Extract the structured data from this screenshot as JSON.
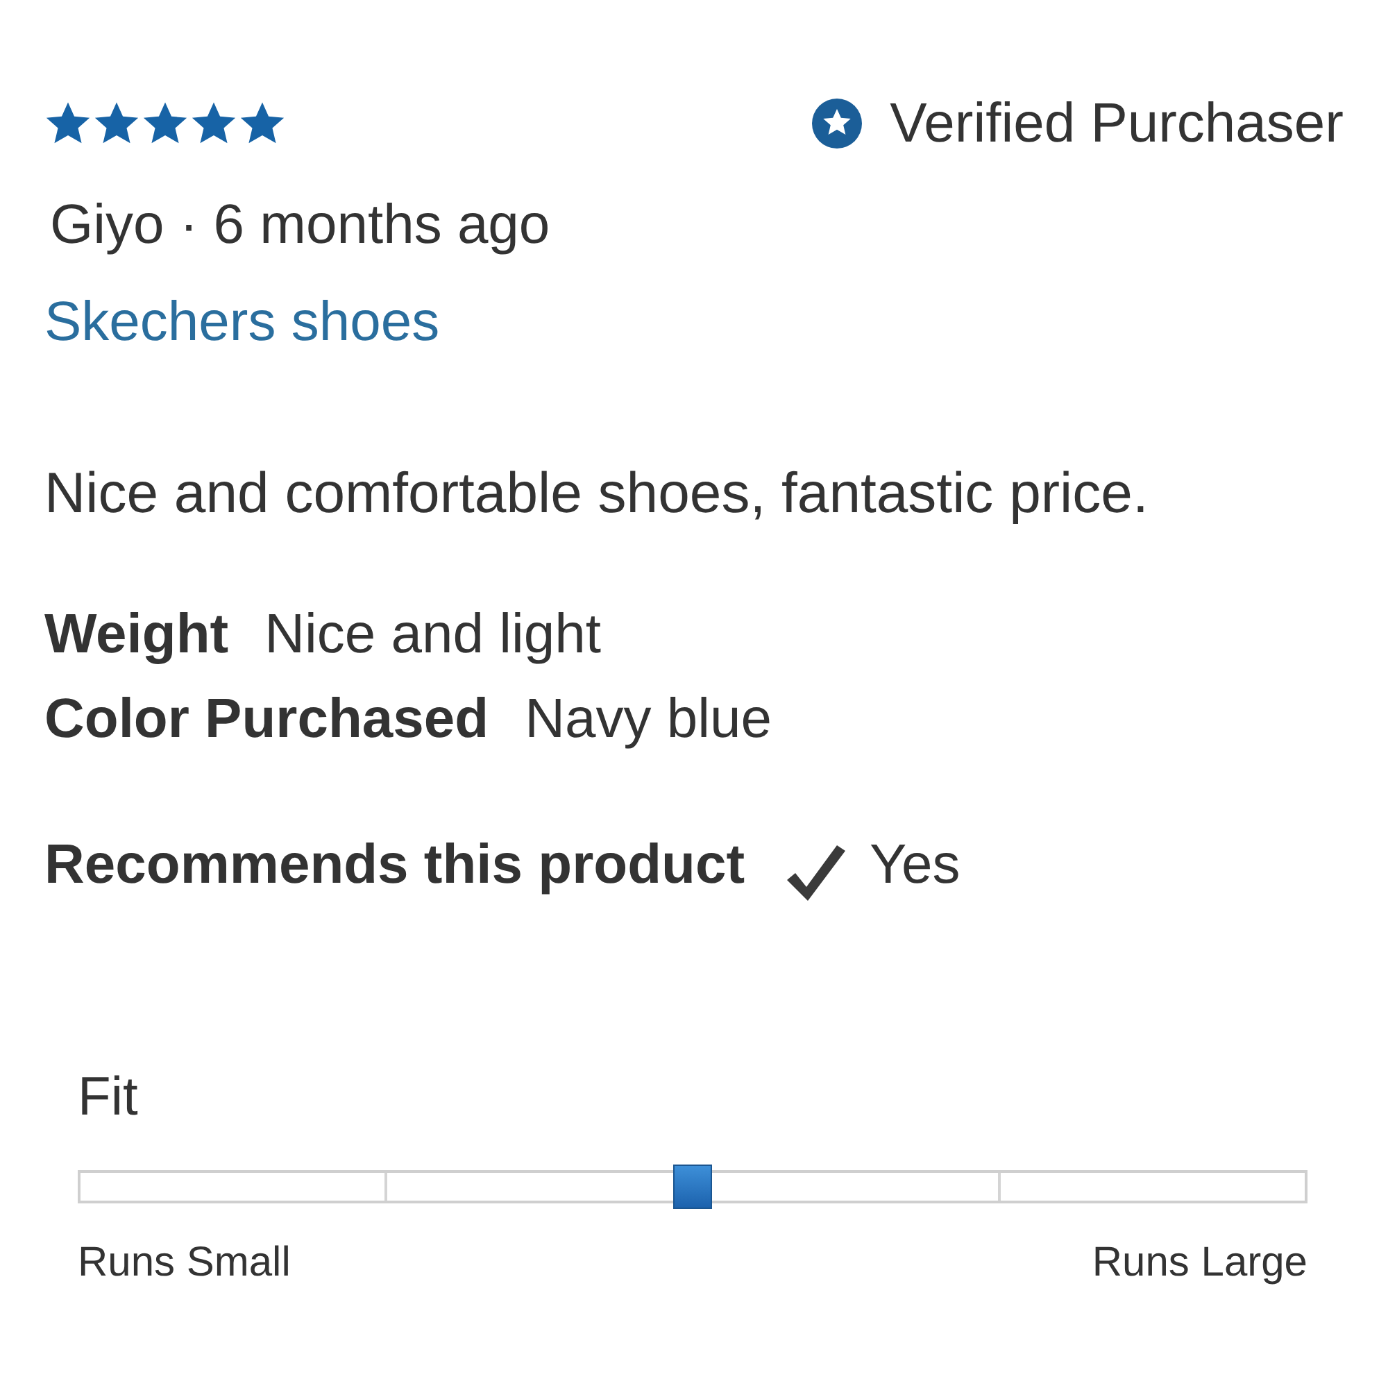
{
  "rating": {
    "stars": 5
  },
  "badge": {
    "label": "Verified Purchaser"
  },
  "byline": "Giyo · 6 months ago",
  "product_link": "Skechers shoes",
  "review_text": "Nice and comfortable shoes, fantastic price.",
  "attributes": [
    {
      "label": "Weight",
      "value": "Nice and light"
    },
    {
      "label": "Color Purchased",
      "value": "Navy blue"
    }
  ],
  "recommendation": {
    "label": "Recommends this product",
    "recommended": true,
    "answer": "Yes"
  },
  "fit": {
    "label": "Fit",
    "level": 0.5,
    "min_label": "Runs Small",
    "max_label": "Runs Large"
  }
}
